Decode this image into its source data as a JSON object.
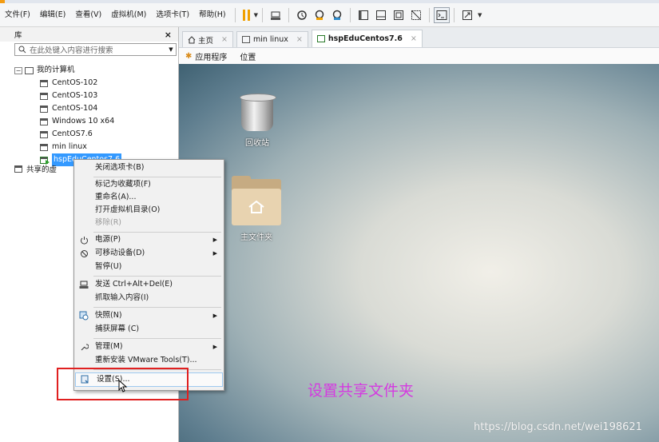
{
  "menubar": {
    "items": [
      "文件(F)",
      "编辑(E)",
      "查看(V)",
      "虚拟机(M)",
      "选项卡(T)",
      "帮助(H)"
    ]
  },
  "toolbar": {
    "icons": [
      "pause-icon",
      "send-ctrl-alt-del-icon",
      "snapshot-icon",
      "revert-snapshot-icon",
      "manage-snapshots-icon",
      "full-screen-icon",
      "console-view-icon",
      "unity-icon",
      "quick-switch-icon",
      "terminal-icon",
      "stretch-icon"
    ]
  },
  "library": {
    "title": "库",
    "close": "×",
    "search_placeholder": "在此处键入内容进行搜索",
    "root": "我的计算机",
    "vms": [
      "CentOS-102",
      "CentOS-103",
      "CentOS-104",
      "Windows 10 x64",
      "CentOS7.6",
      "min linux",
      "hspEduCentos7.6"
    ],
    "selected_vm": "hspEduCentos7.6",
    "shared": "共享的虚"
  },
  "tabs": [
    {
      "label": "主页",
      "close": "×"
    },
    {
      "label": "min linux",
      "close": "×"
    },
    {
      "label": "hspEduCentos7.6",
      "close": "×"
    }
  ],
  "gnome_bar": {
    "applications": "应用程序",
    "places": "位置"
  },
  "desktop": {
    "trash_label": "回收站",
    "home_label": "主文件夹"
  },
  "context_menu": {
    "items": [
      {
        "label": "关闭选项卡(B)",
        "icon": "",
        "submenu": false,
        "disabled": false
      },
      {
        "label": "标记为收藏项(F)",
        "icon": "",
        "submenu": false,
        "disabled": false
      },
      {
        "label": "重命名(A)...",
        "icon": "",
        "submenu": false,
        "disabled": false
      },
      {
        "label": "打开虚拟机目录(O)",
        "icon": "",
        "submenu": false,
        "disabled": false
      },
      {
        "label": "移除(R)",
        "icon": "",
        "submenu": false,
        "disabled": true
      },
      {
        "label": "电源(P)",
        "icon": "power-icon",
        "submenu": true,
        "disabled": false
      },
      {
        "label": "可移动设备(D)",
        "icon": "removable-devices-icon",
        "submenu": true,
        "disabled": false
      },
      {
        "label": "暂停(U)",
        "icon": "",
        "submenu": false,
        "disabled": false
      },
      {
        "label": "发送 Ctrl+Alt+Del(E)",
        "icon": "keyboard-icon",
        "submenu": false,
        "disabled": false
      },
      {
        "label": "抓取输入内容(I)",
        "icon": "",
        "submenu": false,
        "disabled": false
      },
      {
        "label": "快照(N)",
        "icon": "snapshot-icon",
        "submenu": true,
        "disabled": false
      },
      {
        "label": "捕获屏幕 (C)",
        "icon": "",
        "submenu": false,
        "disabled": false
      },
      {
        "label": "管理(M)",
        "icon": "wrench-icon",
        "submenu": true,
        "disabled": false
      },
      {
        "label": "重新安装 VMware Tools(T)...",
        "icon": "",
        "submenu": false,
        "disabled": false
      },
      {
        "label": "设置(S)...",
        "icon": "settings-icon",
        "submenu": false,
        "disabled": false
      }
    ]
  },
  "annotation": {
    "caption": "设置共享文件夹",
    "highlight_color": "#e02020",
    "caption_color": "#d43be0"
  },
  "watermark": "https://blog.csdn.net/wei198621"
}
